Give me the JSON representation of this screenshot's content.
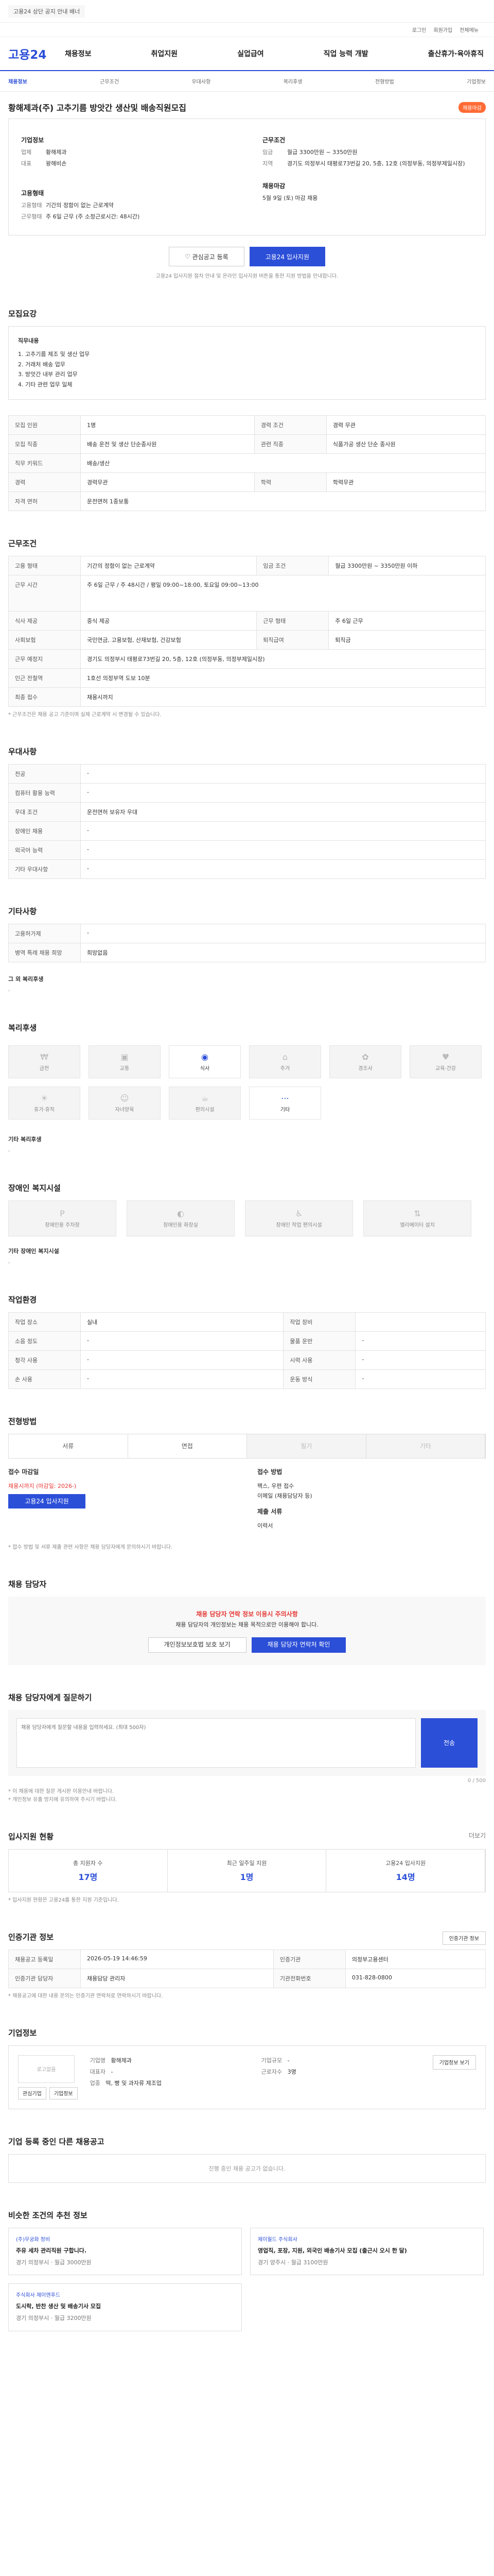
{
  "banner": {
    "message": "고용24 상단 공지 안내 배너"
  },
  "util": [
    "로그인",
    "회원가입",
    "전체메뉴"
  ],
  "gnb": {
    "logo": "고용24",
    "menu": [
      "채용정보",
      "취업지원",
      "실업급여",
      "직업 능력 개발",
      "출산휴가·육아휴직"
    ]
  },
  "subtabs": [
    "채용정보",
    "근무조건",
    "우대사항",
    "복리후생",
    "전형방법",
    "기업정보"
  ],
  "job": {
    "title": "황해제과(주) 고추기름 방앗간 생산및 배송직원모집",
    "status": "채용마감",
    "company_h": "기업정보",
    "company": [
      [
        "업체",
        "황해제과"
      ],
      [
        "대표",
        "왕해비손"
      ]
    ],
    "cond_h": "근무조건",
    "cond": [
      [
        "임금",
        "월급 3300만원 ~ 3350만원"
      ],
      [
        "지역",
        "경기도 의정부시 태평로73번길 20, 5층, 12호 (의정부동, 의정부제일시장)"
      ]
    ],
    "emp_h": "고용형태",
    "emp": [
      [
        "고용형태",
        "기간의 정함이 없는 근로계약"
      ],
      [
        "근무형태",
        "주 6일 근무 (주 소정근로시간: 48시간)"
      ]
    ],
    "deadline_h": "채용마감",
    "deadline": "5월 9일 (토) 마감 채용"
  },
  "actions": {
    "favorite": "관심공고 등록",
    "apply": "고용24 입사지원"
  },
  "apply_note": "고용24 입사지원 절차 안내 및 온라인 입사지원 버튼을 통한 지원 방법을 안내합니다.",
  "recruit": {
    "h": "모집요강",
    "task_h": "직무내용",
    "tasks": [
      "1. 고추기름 제조 및 생산 업무",
      "2. 거래처 배송 업무",
      "3. 방앗간 내부 관리 업무",
      "4. 기타 관련 업무 일체"
    ],
    "rows": [
      [
        "모집 인원",
        "1명",
        "경력 조건",
        "경력 무관"
      ],
      [
        "모집 직종",
        "배송 운전 및 생산 단순종사원",
        "관련 직종",
        "식품가공 생산 단순 종사원"
      ],
      [
        "직무 키워드",
        "배송/생산",
        "",
        ""
      ],
      [
        "경력",
        "경력무관",
        "학력",
        "학력무관"
      ],
      [
        "자격 면허",
        "운전면허 1종보통",
        "",
        ""
      ]
    ]
  },
  "work": {
    "h": "근무조건",
    "rows": [
      [
        "고용 형태",
        "기간의 정함이 없는 근로계약",
        "임금 조건",
        "월급 3300만원 ~ 3350만원 이하"
      ],
      [
        "근무 시간",
        "주 6일 근무 / 주 48시간 / 평일 09:00~18:00, 토요일 09:00~13:00",
        "",
        ""
      ],
      [
        "식사 제공",
        "중식 제공",
        "근무 형태",
        "주 6일 근무"
      ],
      [
        "사회보험",
        "국민연금, 고용보험, 산재보험, 건강보험",
        "퇴직급여",
        "퇴직금"
      ],
      [
        "근무 예정지",
        "경기도 의정부시 태평로73번길 20, 5층, 12호 (의정부동, 의정부제일시장)",
        "",
        ""
      ],
      [
        "인근 전철역",
        "1호선 의정부역 도보 10분",
        "",
        ""
      ],
      [
        "최종 접수",
        "채용시까지",
        "",
        ""
      ]
    ],
    "note": "* 근무조건은 채용 공고 기준이며 실제 근로계약 시 변경될 수 있습니다."
  },
  "pref": {
    "h": "우대사항",
    "rows": [
      [
        "전공",
        "-"
      ],
      [
        "컴퓨터 활용 능력",
        "-"
      ],
      [
        "우대 조건",
        "운전면허 보유자 우대"
      ],
      [
        "장애인 채용",
        "-"
      ],
      [
        "외국어 능력",
        "-"
      ],
      [
        "기타 우대사항",
        "-"
      ]
    ]
  },
  "etc": {
    "h": "기타사항",
    "rows": [
      [
        "고용허가제",
        "-"
      ],
      [
        "병역 특례 채용 희망",
        "희망없음"
      ]
    ],
    "more_h": "그 외 복리후생",
    "more": "-"
  },
  "welfare": {
    "h": "복리후생",
    "items": [
      {
        "icon": "money-icon",
        "label": "금전",
        "on": false
      },
      {
        "icon": "car-icon",
        "label": "교통",
        "on": false
      },
      {
        "icon": "meal-icon",
        "label": "식사",
        "on": true
      },
      {
        "icon": "house-icon",
        "label": "주거",
        "on": false
      },
      {
        "icon": "gift-icon",
        "label": "경조사",
        "on": false
      },
      {
        "icon": "family-icon",
        "label": "교육·건강",
        "on": false
      },
      {
        "icon": "vacation-icon",
        "label": "휴가·휴직",
        "on": false
      },
      {
        "icon": "care-icon",
        "label": "자녀양육",
        "on": false
      },
      {
        "icon": "rest-icon",
        "label": "편의시설",
        "on": false
      },
      {
        "icon": "etc-icon",
        "label": "기타",
        "on": true
      }
    ],
    "extra_h": "기타 복리후생",
    "extra": "-"
  },
  "disability": {
    "h": "장애인 복지시설",
    "items": [
      "장애인용 주차장",
      "장애인용 화장실",
      "장애인 작업 편의시설",
      "엘리베이터 설치"
    ],
    "extra_h": "기타 장애인 복지시설",
    "extra": "-"
  },
  "env": {
    "h": "작업환경",
    "rows": [
      [
        "작업 장소",
        "실내",
        "작업 장비",
        ""
      ],
      [
        "소음 정도",
        "-",
        "물품 운반",
        "-"
      ],
      [
        "청각 사용",
        "-",
        "시력 사용",
        "-"
      ],
      [
        "손 사용",
        "-",
        "운동 방식",
        "-"
      ]
    ]
  },
  "selection": {
    "h": "전형방법",
    "steps": [
      "서류",
      "면접",
      "필기",
      "기타"
    ],
    "apply_h": "접수 마감일",
    "apply_lines": [
      "채용시까지 (마감일: 2026-)",
      "고용24 입사지원"
    ],
    "method_h": "접수 방법",
    "method": [
      "팩스, 우편 접수",
      "이메일 (채용담당자 등)"
    ],
    "docs_h": "제출 서류",
    "docs": [
      "이력서"
    ],
    "note": "* 접수 방법 및 서류 제출 관련 사항은 채용 담당자에게 문의하시기 바랍니다."
  },
  "contact": {
    "h": "채용 담당자",
    "warn1": "채용 담당자 연락 정보 이용시 주의사항",
    "warn2": "채용 담당자의 개인정보는 채용 목적으로만 이용해야 합니다.",
    "buttons": [
      "개인정보보호법 보호 보기",
      "채용 담당자 연락처 확인"
    ]
  },
  "qna": {
    "h": "채용 담당자에게 질문하기",
    "placeholder": "채용 담당자에게 질문할 내용을 입력하세요. (최대 500자)",
    "send": "전송",
    "counter": "0 / 500",
    "notes": [
      "* 이 채용에 대한 질문 게시판 이용안내 바랍니다.",
      "* 개인정보 유출 방지에 유의하여 주시기 바랍니다."
    ]
  },
  "stats": {
    "h": "입사지원 현황",
    "more": "더보기",
    "items": [
      [
        "총 지원자 수",
        "17명"
      ],
      [
        "최근 일주일 지원",
        "1명"
      ],
      [
        "고용24 입사지원",
        "14명"
      ]
    ],
    "note": "* 입사지원 현황은 고용24를 통한 지원 기준입니다."
  },
  "info": {
    "h": "인증기관 정보",
    "btn": "인증기관 정보",
    "rows": [
      [
        "채용공고 등록일",
        "2026-05-19 14:46:59",
        "인증기관",
        "의정부고용센터"
      ],
      [
        "인증기관 담당자",
        "채용담당 관리자",
        "기관전화번호",
        "031-828-0800"
      ]
    ],
    "note": "* 채용공고에 대한 내용 문의는 인증기관 연락처로 연락하시기 바랍니다."
  },
  "company": {
    "h": "기업정보",
    "logo": "로고없음",
    "name_l": "기업명",
    "name": "황해제과",
    "rep_l": "대표자",
    "rep": "-",
    "type_l": "기업규모",
    "type": "-",
    "ind_l": "업종",
    "ind": "떡, 빵 및 과자류 제조업",
    "emp_l": "근로자수",
    "emp": "3명",
    "buttons": [
      "관심기업",
      "기업정보"
    ],
    "site": "기업정보 보기"
  },
  "others": {
    "h": "기업 등록 중인 다른 채용공고",
    "empty": "진행 중인 채용 공고가 없습니다."
  },
  "similar": {
    "h": "비슷한 조건의 추천 정보",
    "cards": [
      {
        "org": "(주)무궁화 정비",
        "title": "주유 세차 관리직원 구합니다.",
        "meta": "경기 의정부시 · 월급 3000만원"
      },
      {
        "org": "제이월드 주식회사",
        "title": "영업직, 포장, 지원, 외국인 배송기사 모집 (출근시 오시 한 달)",
        "meta": "경기 양주시 · 월급 3100만원"
      },
      {
        "org": "주식회사 제이엔푸드",
        "title": "도시락, 반찬 생산 및 배송기사 모집",
        "meta": "경기 의정부시 · 월급 3200만원"
      }
    ]
  }
}
